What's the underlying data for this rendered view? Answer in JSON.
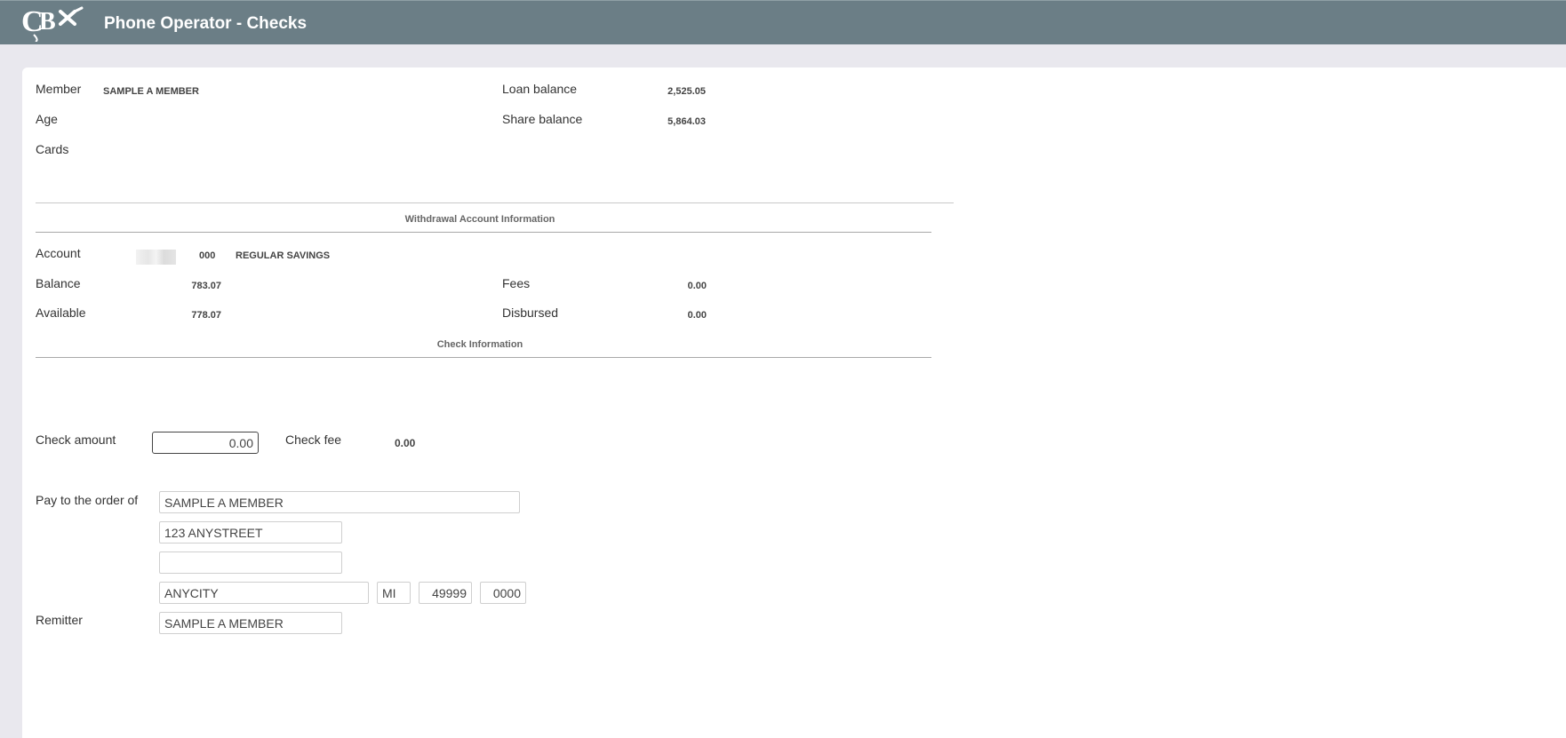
{
  "header": {
    "title": "Phone Operator - Checks",
    "logo_icon": "cbx-logo"
  },
  "member": {
    "member_label": "Member",
    "member_value": "SAMPLE A MEMBER",
    "age_label": "Age",
    "cards_label": "Cards",
    "loan_balance_label": "Loan balance",
    "loan_balance_value": "2,525.05",
    "share_balance_label": "Share balance",
    "share_balance_value": "5,864.03"
  },
  "withdrawal": {
    "section_title": "Withdrawal Account Information",
    "account_label": "Account",
    "account_suffix": "000",
    "account_type": "REGULAR SAVINGS",
    "balance_label": "Balance",
    "balance_value": "783.07",
    "available_label": "Available",
    "available_value": "778.07",
    "fees_label": "Fees",
    "fees_value": "0.00",
    "disbursed_label": "Disbursed",
    "disbursed_value": "0.00"
  },
  "check": {
    "section_title": "Check Information",
    "amount_label": "Check amount",
    "amount_value": "0.00",
    "fee_label": "Check fee",
    "fee_value": "0.00",
    "payee_label": "Pay to the order of",
    "payee_name": "SAMPLE A MEMBER",
    "address1": "123 ANYSTREET",
    "address2": "",
    "city": "ANYCITY",
    "state": "MI",
    "zip": "49999",
    "zip4": "0000",
    "remitter_label": "Remitter",
    "remitter_value": "SAMPLE A MEMBER"
  },
  "colors": {
    "header_bg": "#6b7e86",
    "page_bg": "#e9e8ee",
    "panel_bg": "#ffffff"
  }
}
